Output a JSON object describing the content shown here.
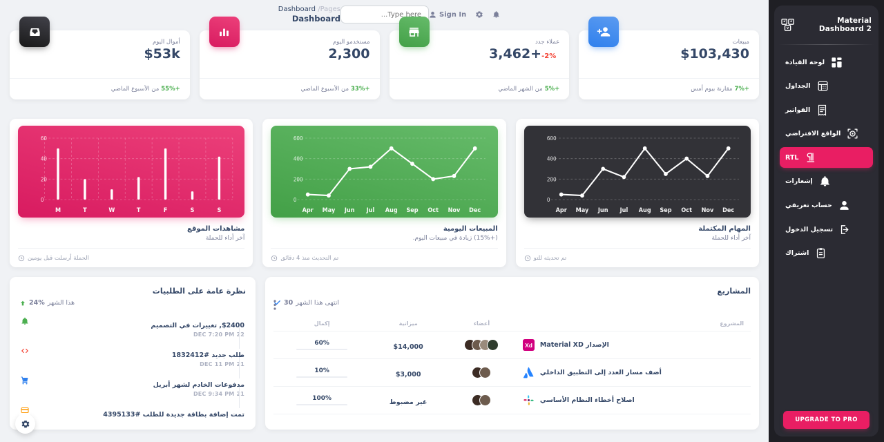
{
  "topnav": {
    "breadcrumb_parent": "Pages",
    "breadcrumb_current": "Dashboard",
    "breadcrumb_sep": "/",
    "page_title": "Dashboard",
    "search_placeholder": "Type here...",
    "search_value": "",
    "signin_label": "Sign In"
  },
  "sidebar": {
    "brand": "Material Dashboard 2",
    "upgrade_label": "UPGRADE TO PRO",
    "items": [
      {
        "label": "لوحة القيادة",
        "icon": "dashboard-icon",
        "active": false
      },
      {
        "label": "الجداول",
        "icon": "table-icon",
        "active": false
      },
      {
        "label": "الفواتير",
        "icon": "receipt-icon",
        "active": false
      },
      {
        "label": "الواقع الافتراضي",
        "icon": "vr-icon",
        "active": false
      },
      {
        "label": "RTL",
        "icon": "rtl-icon",
        "active": true
      },
      {
        "label": "إشعارات",
        "icon": "bell-icon",
        "active": false
      },
      {
        "label": "حساب تعريفي",
        "icon": "person-icon",
        "active": false
      },
      {
        "label": "تسجيل الدخول",
        "icon": "login-icon",
        "active": false
      },
      {
        "label": "اشتراك",
        "icon": "clipboard-icon",
        "active": false
      }
    ]
  },
  "stats": [
    {
      "label": "مبيعات",
      "value": "$103,430",
      "delta": "",
      "delta_color": "",
      "foot_delta": "+7%",
      "foot_text": "مقارنة بيوم أمس",
      "foot_color": "#4caf50",
      "icon": "person-add-icon",
      "icon_color": "#2f80ed"
    },
    {
      "label": "عملاء جدد",
      "value": "3,462+",
      "delta": "-2%",
      "delta_color": "#f44335",
      "foot_delta": "+5%",
      "foot_text": "من الشهر الماضي",
      "foot_color": "#4caf50",
      "icon": "store-icon",
      "icon_color": "#43a047"
    },
    {
      "label": "مستخدمو اليوم",
      "value": "2,300",
      "delta": "",
      "delta_color": "",
      "foot_delta": "+33%",
      "foot_text": "من الأسبوع الماضي",
      "foot_color": "#4caf50",
      "icon": "chart-icon",
      "icon_color": "#d81b60"
    },
    {
      "label": "أموال اليوم",
      "value": "$53k",
      "delta": "",
      "delta_color": "",
      "foot_delta": "+55%",
      "foot_text": "من الأسبوع الماضي",
      "foot_color": "#4caf50",
      "icon": "inbox-icon",
      "icon_color": "#323237"
    }
  ],
  "chart_data": [
    {
      "type": "line",
      "title": "المهام المكتملة",
      "subtitle": "آخر أداء للحملة",
      "footer": "تم تحديثه للتو",
      "categories": [
        "Apr",
        "May",
        "Jun",
        "Jul",
        "Aug",
        "Sep",
        "Oct",
        "Nov",
        "Dec"
      ],
      "values": [
        50,
        40,
        300,
        220,
        500,
        250,
        400,
        230,
        500
      ],
      "yticks": [
        0,
        200,
        400,
        600
      ],
      "ylim": [
        0,
        600
      ],
      "theme": "dark",
      "grid": true,
      "legend": "none"
    },
    {
      "type": "line",
      "title": "المبيعات اليومية",
      "subtitle": "(+15%) زيادة في مبيعات اليوم.",
      "footer": "تم التحديث منذ 4 دقائق",
      "categories": [
        "Apr",
        "May",
        "Jun",
        "Jul",
        "Aug",
        "Sep",
        "Oct",
        "Nov",
        "Dec"
      ],
      "values": [
        50,
        40,
        300,
        320,
        500,
        350,
        200,
        230,
        500
      ],
      "yticks": [
        0,
        200,
        400,
        600
      ],
      "ylim": [
        0,
        600
      ],
      "theme": "green",
      "grid": true,
      "legend": "none"
    },
    {
      "type": "bar",
      "title": "مشاهدات الموقع",
      "subtitle": "آخر أداء للحملة",
      "footer": "الحملة أرسلت قبل يومين",
      "categories": [
        "M",
        "T",
        "W",
        "T",
        "F",
        "S",
        "S"
      ],
      "values": [
        50,
        20,
        10,
        22,
        50,
        8,
        42
      ],
      "yticks": [
        0,
        20,
        40,
        60
      ],
      "ylim": [
        0,
        60
      ],
      "theme": "pink",
      "grid": true,
      "legend": "none"
    }
  ],
  "projects": {
    "title": "المشاريع",
    "subtitle_count": "30",
    "subtitle_text": "انتهى هذا الشهر",
    "columns": [
      "المشروع",
      "أعضاء",
      "ميزانية",
      "إكمال"
    ],
    "rows": [
      {
        "name": "الإصدار Material XD",
        "logo": "xd-logo-icon",
        "logo_color": "#d1007f",
        "members": 4,
        "budget": "$14,000",
        "completion": "60%",
        "completion_pct": 60,
        "bar_color": "#2f80ed"
      },
      {
        "name": "أضف مسار العدد إلى التطبيق الداخلي",
        "logo": "atlassian-logo-icon",
        "logo_color": "#2684ff",
        "members": 2,
        "budget": "$3,000",
        "completion": "10%",
        "completion_pct": 10,
        "bar_color": "#49a3f1"
      },
      {
        "name": "اصلاح أخطاء النظام الأساسي",
        "logo": "slack-logo-icon",
        "logo_color": "#4a154b",
        "members": 2,
        "budget": "غير مضبوط",
        "completion": "100%",
        "completion_pct": 100,
        "bar_color": "#4caf50"
      }
    ]
  },
  "orders": {
    "title": "نظرة عامة على الطلبيات",
    "subtitle_pct": "24%",
    "subtitle_text": "هذا الشهر",
    "items": [
      {
        "title": "$2400, تغييرات في التصميم",
        "time": "22 DEC 7:20 PM",
        "icon": "bell-icon",
        "color": "#4caf50"
      },
      {
        "title": "طلب جديد #1832412",
        "time": "21 DEC 11 PM",
        "icon": "code-icon",
        "color": "#f44335"
      },
      {
        "title": "مدفوعات الخادم لشهر أبريل",
        "time": "21 DEC 9:34 PM",
        "icon": "cart-icon",
        "color": "#2f80ed"
      },
      {
        "title": "تمت إضافة بطاقة جديدة للطلب #4395133",
        "time": "",
        "icon": "card-icon",
        "color": "#ff9800"
      }
    ]
  },
  "fab": {
    "icon": "gear-icon"
  }
}
